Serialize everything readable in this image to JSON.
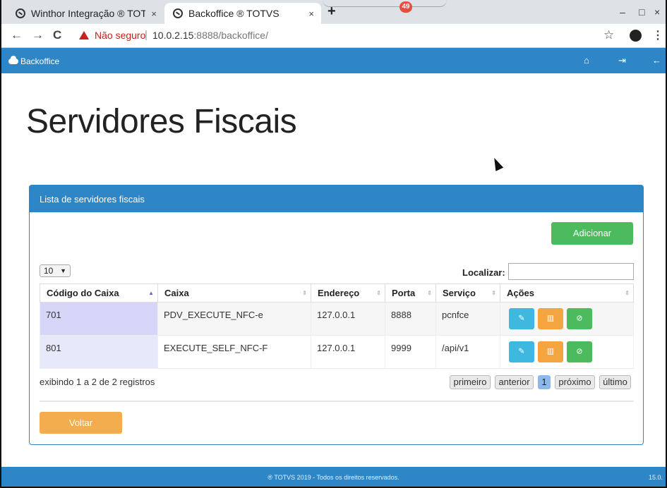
{
  "browser": {
    "tabs": [
      {
        "title": "Winthor Integração ® TOTVS",
        "close": "×"
      },
      {
        "title": "Backoffice ® TOTVS",
        "close": "×"
      }
    ],
    "new_tab": "+",
    "tab_badge": "49",
    "window_controls": {
      "minimize": "–",
      "maximize": "□",
      "close": "×"
    },
    "nav": {
      "back": "←",
      "forward": "→",
      "reload": "C"
    },
    "security_text": "Não seguro",
    "url_host": "10.0.2.15",
    "url_rest": ":8888/backoffice/",
    "star": "☆",
    "menu": "⋮"
  },
  "appnav": {
    "brand": "Backoffice",
    "icons": [
      "home-icon",
      "sign-out-icon",
      "arrow-left-icon"
    ],
    "icon_glyphs": {
      "home": "⌂",
      "signout": "⇥",
      "back": "←"
    }
  },
  "page": {
    "title": "Servidores Fiscais"
  },
  "panel": {
    "heading": "Lista de servidores fiscais",
    "add_button": "Adicionar",
    "page_size": "10",
    "page_size_caret": "▼",
    "search_label": "Localizar:",
    "search_value": "",
    "columns": [
      "Código do Caixa",
      "Caixa",
      "Endereço",
      "Porta",
      "Serviço",
      "Ações"
    ],
    "rows": [
      {
        "codigo": "701",
        "caixa": "PDV_EXECUTE_NFC-e",
        "endereco": "127.0.0.1",
        "porta": "8888",
        "servico": "pcnfce"
      },
      {
        "codigo": "801",
        "caixa": "EXECUTE_SELF_NFC-F",
        "endereco": "127.0.0.1",
        "porta": "9999",
        "servico": "/api/v1"
      }
    ],
    "action_glyphs": {
      "edit": "✎",
      "delete": "▥",
      "block": "⊘"
    },
    "info": "exibindo 1 a 2 de 2 registros",
    "pager": {
      "first": "primeiro",
      "prev": "anterior",
      "current": "1",
      "next": "próximo",
      "last": "último"
    },
    "back_button": "Voltar"
  },
  "footer": {
    "copyright": "® TOTVS 2019 - Todos os direitos reservados.",
    "version": "15.0."
  },
  "colors": {
    "primary": "#2f86c6",
    "success": "#4cbb5e",
    "warning": "#f4ad4e",
    "info": "#3fb8e0"
  }
}
